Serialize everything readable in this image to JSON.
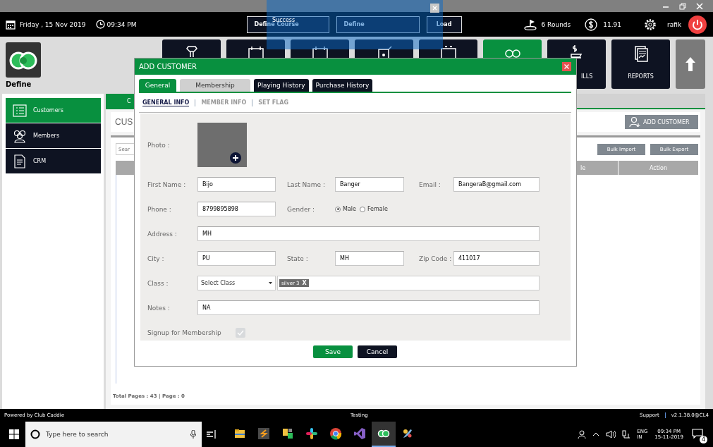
{
  "top_bar": {
    "date": "Friday , 15 Nov 2019",
    "time": "09:34 PM",
    "selects": [
      {
        "value": "Define Course"
      },
      {
        "value": "Define"
      }
    ],
    "load_button": "Load",
    "rounds": "6 Rounds",
    "balance": "11.91",
    "user": "rafik"
  },
  "toast": {
    "message": "Success"
  },
  "app": {
    "name": "Define"
  },
  "nav_tiles": [
    {
      "selected": false
    },
    {
      "selected": false
    },
    {
      "selected": false
    },
    {
      "selected": false
    },
    {
      "selected": false
    },
    {
      "selected": true
    },
    {
      "selected": false,
      "label": "ILLS"
    },
    {
      "selected": false,
      "label": "REPORTS"
    }
  ],
  "sidebar": {
    "items": [
      {
        "label": "Customers",
        "selected": true
      },
      {
        "label": "Members",
        "selected": false
      },
      {
        "label": "CRM",
        "selected": false
      }
    ]
  },
  "content": {
    "tab": "C",
    "heading": "CUS",
    "add_button": "ADD CUSTOMER",
    "search_placeholder": "Sear",
    "bulk_buttons": [
      "Bulk Import",
      "Bulk Export"
    ],
    "columns": [
      "le",
      "Action"
    ],
    "pagination": "Total Pages : 43 | Page : 0"
  },
  "dialog": {
    "title": "ADD CUSTOMER",
    "tabs": [
      {
        "label": "General",
        "selected": true,
        "disabled": false
      },
      {
        "label": "Membership",
        "selected": false,
        "disabled": true
      },
      {
        "label": "Playing History",
        "selected": false,
        "disabled": false
      },
      {
        "label": "Purchase History",
        "selected": false,
        "disabled": false
      }
    ],
    "subtabs": [
      {
        "label": "GENERAL INFO",
        "selected": true
      },
      {
        "label": "MEMBER INFO",
        "selected": false
      },
      {
        "label": "SET FLAG",
        "selected": false
      }
    ],
    "photo_label": "Photo :",
    "rows": [
      [
        {
          "kind": "text",
          "label": "First Name :",
          "value": "Bijo"
        },
        {
          "kind": "text",
          "label": "Last Name :",
          "value": "Banger"
        },
        {
          "kind": "text",
          "label": "Email :",
          "value": "BangeraB@gmail.com"
        }
      ],
      [
        {
          "kind": "text",
          "label": "Phone :",
          "value": "8799895898"
        },
        {
          "kind": "radio",
          "label": "Gender :",
          "options": [
            {
              "label": "Male",
              "selected": true
            },
            {
              "label": "Female",
              "selected": false
            }
          ]
        }
      ],
      [
        {
          "kind": "text",
          "label": "Address :",
          "value": "MH"
        }
      ],
      [
        {
          "kind": "text",
          "label": "City :",
          "value": "PU"
        },
        {
          "kind": "text",
          "label": "State :",
          "value": "MH"
        },
        {
          "kind": "text",
          "label": "Zip Code :",
          "value": "411017"
        }
      ],
      [
        {
          "kind": "class",
          "label": "Class :",
          "value": "Select Class",
          "tags": [
            {
              "label": "silver 3",
              "remove": "X"
            }
          ]
        }
      ],
      [
        {
          "kind": "text",
          "label": "Notes :",
          "value": "NA"
        }
      ],
      [
        {
          "kind": "checkbox",
          "label": "Signup for Membership",
          "checked": true,
          "disabled": true
        }
      ]
    ],
    "buttons": [
      {
        "label": "Save",
        "kind": "primary"
      },
      {
        "label": "Cancel",
        "kind": "secondary"
      }
    ]
  },
  "footer": {
    "left": "Powered by Club Caddie",
    "center": "Testing",
    "support": "Support",
    "version": "v2.1.38.0@CL4"
  },
  "taskbar": {
    "search_placeholder": "Type here to search",
    "apps": [
      {
        "selected": false
      },
      {
        "selected": false
      },
      {
        "selected": false
      },
      {
        "selected": false
      },
      {
        "selected": false
      },
      {
        "selected": false
      },
      {
        "selected": true
      },
      {
        "selected": false
      }
    ],
    "language": [
      "ENG",
      "IN"
    ],
    "time": "09:34 PM",
    "date": "15-11-2019",
    "notifications": "4"
  }
}
